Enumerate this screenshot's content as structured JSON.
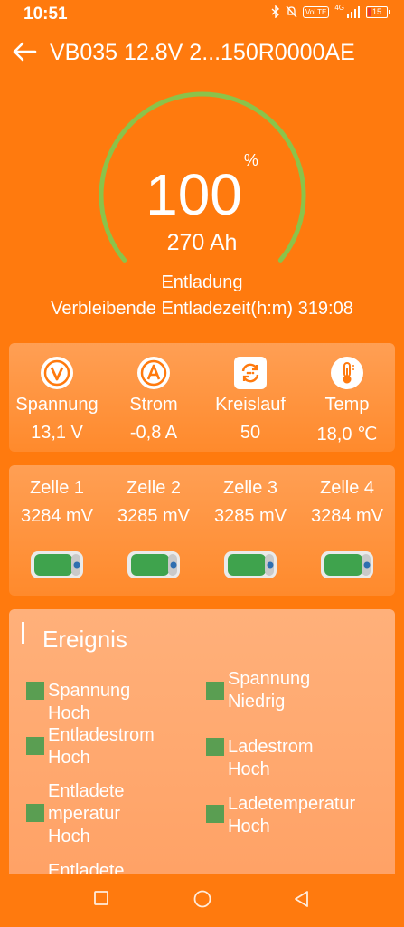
{
  "status_bar": {
    "time": "10:51",
    "network": "4G",
    "volte": "VoLTE",
    "battery": "15",
    "battery_level_percent": 15
  },
  "header": {
    "title": "VB035 12.8V 2...150R0000AE",
    "back_icon": "arrow-left-icon"
  },
  "gauge": {
    "percent": "100",
    "percent_unit": "%",
    "capacity": "270 Ah",
    "mode": "Entladung",
    "remaining": "Verbleibende Entladezeit(h:m) 319:08",
    "fill_fraction": 0.72,
    "arc_color": "#8BC34A"
  },
  "stats": [
    {
      "icon": "voltage-icon",
      "label": "Spannung",
      "value": "13,1 V"
    },
    {
      "icon": "current-icon",
      "label": "Strom",
      "value": "-0,8 A"
    },
    {
      "icon": "cycle-icon",
      "label": "Kreislauf",
      "value": "50"
    },
    {
      "icon": "thermometer-icon",
      "label": "Temp",
      "value": "18,0 ℃"
    }
  ],
  "cells": [
    {
      "name": "Zelle 1",
      "voltage": "3284 mV"
    },
    {
      "name": "Zelle 2",
      "voltage": "3285 mV"
    },
    {
      "name": "Zelle 3",
      "voltage": "3285 mV"
    },
    {
      "name": "Zelle 4",
      "voltage": "3284 mV"
    }
  ],
  "events": {
    "title": "Ereignis",
    "items": [
      {
        "line1": "Spannung Hoch"
      },
      {
        "line1": "Spannung",
        "line2": "Niedrig"
      },
      {
        "line1": "Entladestrom",
        "line2": "Hoch"
      },
      {
        "line1": "Ladestrom Hoch"
      },
      {
        "line1": "Entladete",
        "line2": "mperatur",
        "line3": "Hoch"
      },
      {
        "line1": "Ladetemperatur",
        "line2": "Hoch"
      },
      {
        "line1": "Entladete"
      }
    ],
    "indicator_color": "#5A9E52"
  },
  "colors": {
    "background": "#FF7A0E",
    "accent": "#FF7A0E"
  }
}
